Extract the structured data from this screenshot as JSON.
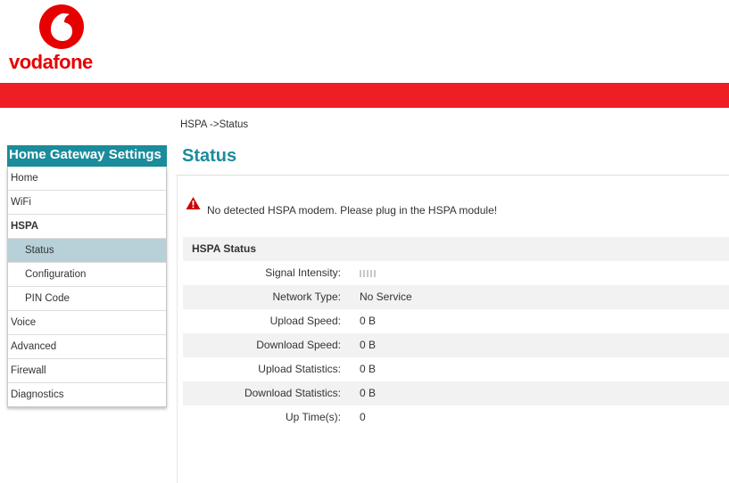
{
  "brand": {
    "name": "vodafone",
    "logo_icon": "vodafone-speechmark-icon",
    "primary_color": "#e60000",
    "bar_color": "#ee1e24",
    "accent_color": "#1a8c9b"
  },
  "breadcrumb": "HSPA ->Status",
  "sidebar": {
    "title": "Home Gateway Settings",
    "items": [
      {
        "label": "Home"
      },
      {
        "label": "WiFi"
      },
      {
        "label": "HSPA"
      },
      {
        "label": "Status"
      },
      {
        "label": "Configuration"
      },
      {
        "label": "PIN Code"
      },
      {
        "label": "Voice"
      },
      {
        "label": "Advanced"
      },
      {
        "label": "Firewall"
      },
      {
        "label": "Diagnostics"
      }
    ],
    "active": "Status"
  },
  "main": {
    "title": "Status",
    "warning": {
      "icon": "warning-triangle-icon",
      "text": "No detected HSPA modem. Please plug in the HSPA module!"
    },
    "hspa_status": {
      "header": "HSPA Status",
      "rows": [
        {
          "label": "Signal Intensity:",
          "value": "",
          "signal_bars": 0,
          "signal_bars_total": 5
        },
        {
          "label": "Network Type:",
          "value": "No Service"
        },
        {
          "label": "Upload Speed:",
          "value": "0 B"
        },
        {
          "label": "Download Speed:",
          "value": "0 B"
        },
        {
          "label": "Upload Statistics:",
          "value": "0 B"
        },
        {
          "label": "Download Statistics:",
          "value": "0 B"
        },
        {
          "label": "Up Time(s):",
          "value": "0"
        }
      ]
    }
  }
}
